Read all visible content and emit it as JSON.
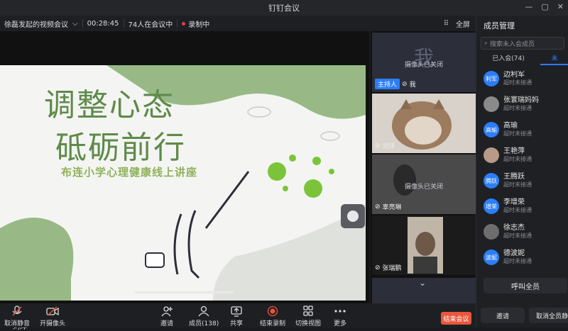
{
  "window": {
    "title": "钉钉会议"
  },
  "infobar": {
    "meeting_name": "徐磊发起的视频会议",
    "duration": "00:28:45",
    "participants": "74人在会议中",
    "recording": "录制中",
    "fullscreen": "全屏"
  },
  "slide": {
    "line1": "调整心态",
    "line2": "砥砺前行",
    "line3": "布连小学心理健康线上讲座"
  },
  "stage": {
    "speaker": "刘洋"
  },
  "tiles": [
    {
      "big": "我",
      "camera_status": "摄像头已关闭",
      "host_tag": "主持人",
      "name": "我"
    },
    {
      "name": "刘洋"
    },
    {
      "camera_status": "摄像头已关闭",
      "name": "辜亮琳"
    },
    {
      "name": "张瑞鹏"
    }
  ],
  "panel": {
    "title": "成员管理",
    "search_placeholder": "搜索未入会成员",
    "tabs": [
      "已入会(74)",
      "未"
    ],
    "members": [
      {
        "avatar": "利军",
        "name": "边利军",
        "status": "超时未接通"
      },
      {
        "name": "张寰瑞妈妈",
        "status": "超时未接通"
      },
      {
        "avatar": "高瑜",
        "name": "高瑜",
        "status": "超时未接通"
      },
      {
        "name": "王艳萍",
        "status": "超时未接通"
      },
      {
        "avatar": "腾跃",
        "name": "王腾跃",
        "status": "超时未接通"
      },
      {
        "avatar": "增荣",
        "name": "李增荣",
        "status": "超时未接通"
      },
      {
        "name": "徐志杰",
        "status": "超时未接通"
      },
      {
        "avatar": "波妮",
        "name": "德波妮",
        "status": "超时未接通"
      }
    ],
    "call_all": "呼叫全员",
    "invite": "邀请",
    "unmute_all": "取消全员静音"
  },
  "toolbar": {
    "mute": "取消静音",
    "camera": "开摄像头",
    "invite": "邀请",
    "members": "成员(138)",
    "share": "共享",
    "stop_record": "结束录制",
    "switch_view": "切换视图",
    "more": "更多",
    "end_meeting": "结束会议"
  },
  "colors": {
    "accent": "#2c7ef8",
    "record": "#e23d3d",
    "end": "#e8573d",
    "slide_green": "#5e8a4a"
  }
}
